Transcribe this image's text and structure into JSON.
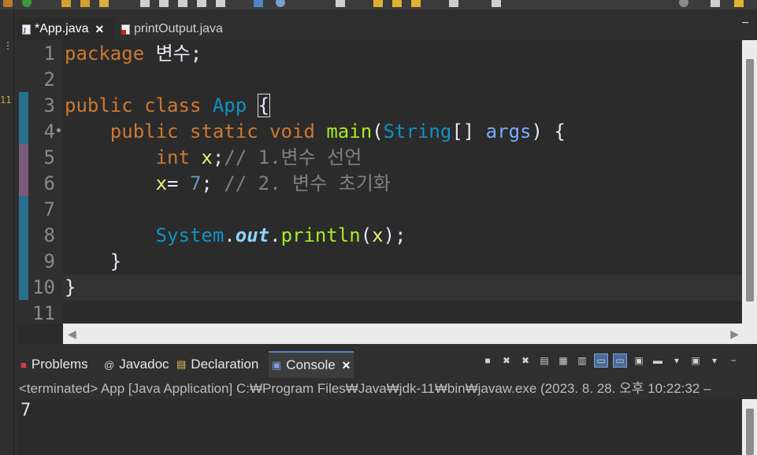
{
  "editor": {
    "tabs": [
      {
        "label": "*App.java",
        "close": "✕",
        "active": true
      },
      {
        "label": "printOutput.java",
        "active": false
      }
    ],
    "minimize": "−",
    "line_numbers": [
      "1",
      "2",
      "3",
      "4",
      "5",
      "6",
      "7",
      "8",
      "9",
      "10",
      "11"
    ],
    "code": {
      "l1_kw": "package",
      "l1_rest": " 변수;",
      "l3_kw1": "public",
      "l3_kw2": "class",
      "l3_cls": "App",
      "l3_brace": "{",
      "l4_kw1": "public",
      "l4_kw2": "static",
      "l4_kw3": "void",
      "l4_mth": "main",
      "l4_p1": "(",
      "l4_type": "String",
      "l4_arr": "[]",
      "l4_arg": "args",
      "l4_end": ") {",
      "l5_kw": "int",
      "l5_var": "x",
      "l5_semi": ";",
      "l5_cmt": "// 1.변수 선언",
      "l6_var": "x",
      "l6_eq": "= ",
      "l6_num": "7",
      "l6_semi": ";",
      "l6_cmt": " // 2. 변수 초기화",
      "l8_cls": "System",
      "l8_dot": ".",
      "l8_field": "out",
      "l8_dot2": ".",
      "l8_mth": "println",
      "l8_p1": "(",
      "l8_arg": "x",
      "l8_end": ");",
      "l9": "}",
      "l10": "}"
    }
  },
  "left_strip": {
    "dots": "⋮",
    "ruler": "11"
  },
  "console": {
    "tabs": [
      {
        "icon": "problems-icon",
        "label": "Problems"
      },
      {
        "icon": "javadoc-icon",
        "label": "Javadoc"
      },
      {
        "icon": "declaration-icon",
        "label": "Declaration"
      },
      {
        "icon": "console-icon",
        "label": "Console",
        "close": "✕",
        "active": true
      }
    ],
    "status": "<terminated> App [Java Application] C:₩Program Files₩Java₩jdk-11₩bin₩javaw.exe  (2023. 8. 28. 오후 10:22:32 – ",
    "output": "7",
    "minimize": "−"
  },
  "colors": {
    "background": "#2b2b2b",
    "keyword": "#cc7832",
    "class": "#1290c3",
    "method": "#a7ec21",
    "variable": "#f3ec79",
    "comment": "#808080",
    "change_bar": "#2a6f8c",
    "change_bar_modified": "#7a5a7a"
  }
}
